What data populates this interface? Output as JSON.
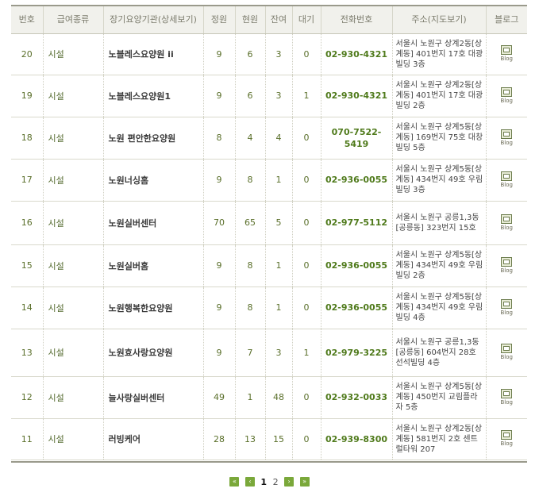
{
  "headers": {
    "no": "번호",
    "kind": "급여종류",
    "name": "장기요양기관(상세보기)",
    "capacity": "정원",
    "current": "현원",
    "remain": "잔여",
    "wait": "대기",
    "tel": "전화번호",
    "addr": "주소(지도보기)",
    "blog": "블로그"
  },
  "blog_icon_text": "Blog",
  "rows": [
    {
      "no": "20",
      "kind": "시설",
      "name": "노블레스요양원 ii",
      "capacity": "9",
      "current": "6",
      "remain": "3",
      "wait": "0",
      "tel": "02-930-4321",
      "addr": "서울시 노원구 상계2동[상계동] 401번지 17호 대광빌딩 3층"
    },
    {
      "no": "19",
      "kind": "시설",
      "name": "노블레스요양원1",
      "capacity": "9",
      "current": "6",
      "remain": "3",
      "wait": "1",
      "tel": "02-930-4321",
      "addr": "서울시 노원구 상계2동[상계동] 401번지 17호 대광빌딩 2층"
    },
    {
      "no": "18",
      "kind": "시설",
      "name": "노원 편안한요양원",
      "capacity": "8",
      "current": "4",
      "remain": "4",
      "wait": "0",
      "tel": "070-7522-5419",
      "addr": "서울시 노원구 상계5동[상계동] 169번지 75호 대창빌딩 5층"
    },
    {
      "no": "17",
      "kind": "시설",
      "name": "노원너싱홈",
      "capacity": "9",
      "current": "8",
      "remain": "1",
      "wait": "0",
      "tel": "02-936-0055",
      "addr": "서울시 노원구 상계5동[상계동] 434번지 49호 우림빌딩 3층"
    },
    {
      "no": "16",
      "kind": "시설",
      "name": "노원실버센터",
      "capacity": "70",
      "current": "65",
      "remain": "5",
      "wait": "0",
      "tel": "02-977-5112",
      "addr": "서울시 노원구 공릉1,3동[공릉동] 323번지 15호"
    },
    {
      "no": "15",
      "kind": "시설",
      "name": "노원실버홈",
      "capacity": "9",
      "current": "8",
      "remain": "1",
      "wait": "0",
      "tel": "02-936-0055",
      "addr": "서울시 노원구 상계5동[상계동] 434번지 49호 우림빌딩 2층"
    },
    {
      "no": "14",
      "kind": "시설",
      "name": "노원행복한요양원",
      "capacity": "9",
      "current": "8",
      "remain": "1",
      "wait": "0",
      "tel": "02-936-0055",
      "addr": "서울시 노원구 상계5동[상계동] 434번지 49호 우림빌딩 4층"
    },
    {
      "no": "13",
      "kind": "시설",
      "name": "노원효사랑요양원",
      "capacity": "9",
      "current": "7",
      "remain": "3",
      "wait": "1",
      "tel": "02-979-3225",
      "addr": "서울시 노원구 공릉1,3동[공릉동] 604번지 28호 선석빌딩 4층"
    },
    {
      "no": "12",
      "kind": "시설",
      "name": "늘사랑실버센터",
      "capacity": "49",
      "current": "1",
      "remain": "48",
      "wait": "0",
      "tel": "02-932-0033",
      "addr": "서울시 노원구 상계5동[상계동] 450번지 교림플라자 5층"
    },
    {
      "no": "11",
      "kind": "시설",
      "name": "러빙케어",
      "capacity": "28",
      "current": "13",
      "remain": "15",
      "wait": "0",
      "tel": "02-939-8300",
      "addr": "서울시 노원구 상계2동[상계동] 581번지 2호 센트럴타워 207"
    }
  ],
  "pager": {
    "first": "«",
    "prev": "‹",
    "pages": [
      "1",
      "2"
    ],
    "current": "1",
    "next": "›",
    "last": "»"
  }
}
